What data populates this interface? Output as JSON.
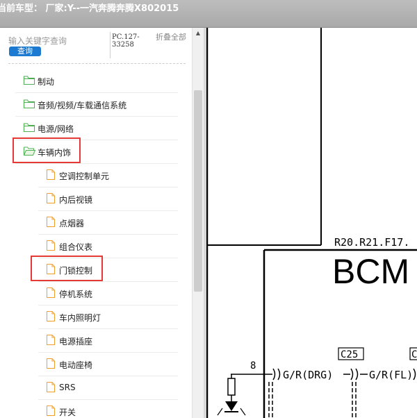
{
  "header": {
    "title": "当前车型： 厂家:Y--一汽奔腾奔腾X802015"
  },
  "search": {
    "placeholder": "输入关键字查询",
    "query_label": "查询",
    "pc_code": "PC.127-33258",
    "collapse_label": "折叠全部"
  },
  "tree": {
    "items": [
      {
        "label": "制动",
        "type": "folder",
        "level": 0,
        "open": false
      },
      {
        "label": "音频/视频/车载通信系统",
        "type": "folder",
        "level": 0,
        "open": false
      },
      {
        "label": "电源/网络",
        "type": "folder",
        "level": 0,
        "open": false
      },
      {
        "label": "车辆内饰",
        "type": "folder",
        "level": 0,
        "open": true,
        "highlighted": true
      },
      {
        "label": "空调控制单元",
        "type": "doc",
        "level": 1
      },
      {
        "label": "内后视镜",
        "type": "doc",
        "level": 1
      },
      {
        "label": "点烟器",
        "type": "doc",
        "level": 1
      },
      {
        "label": "组合仪表",
        "type": "doc",
        "level": 1
      },
      {
        "label": "门锁控制",
        "type": "doc",
        "level": 1,
        "highlighted": true
      },
      {
        "label": "停机系统",
        "type": "doc",
        "level": 1
      },
      {
        "label": "车内照明灯",
        "type": "doc",
        "level": 1
      },
      {
        "label": "电源插座",
        "type": "doc",
        "level": 1
      },
      {
        "label": "电动座椅",
        "type": "doc",
        "level": 1
      },
      {
        "label": "SRS",
        "type": "doc",
        "level": 1
      },
      {
        "label": "开关",
        "type": "doc",
        "level": 1
      }
    ]
  },
  "diagram": {
    "connector_refs": "R20.R21.F17.",
    "module_name": "BCM",
    "connector_c25": "C25",
    "connector_partial": "C",
    "pin_number": "8",
    "wire_drg": "G/R(DRG)",
    "wire_fl": "G/R(FL)"
  },
  "colors": {
    "accent": "#1c7bd1",
    "highlight": "#e53935",
    "folder_icon": "#4caf50",
    "doc_icon": "#f0a030",
    "header_bg": "#b3b3b3"
  }
}
